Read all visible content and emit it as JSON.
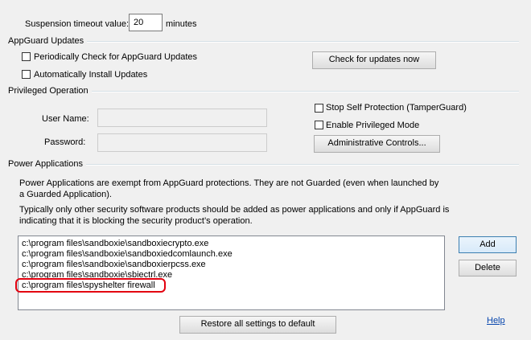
{
  "suspension": {
    "label": "Suspension timeout value:",
    "value": "20",
    "unit": "minutes"
  },
  "updates": {
    "group_title": "AppGuard Updates",
    "periodic_check_label": "Periodically Check for AppGuard Updates",
    "periodic_check_checked": false,
    "auto_install_label": "Automatically Install Updates",
    "auto_install_checked": false,
    "check_now_button": "Check for updates now"
  },
  "privileged": {
    "group_title": "Privileged Operation",
    "username_label": "User Name:",
    "username_value": "",
    "password_label": "Password:",
    "password_value": "",
    "stop_self_protection_label": "Stop Self Protection (TamperGuard)",
    "stop_self_protection_checked": false,
    "enable_privileged_label": "Enable Privileged Mode",
    "enable_privileged_checked": false,
    "admin_controls_button": "Administrative Controls..."
  },
  "power_apps": {
    "group_title": "Power Applications",
    "description_1_line_1": "Power Applications are exempt from AppGuard protections.  They are not Guarded (even when launched by",
    "description_1_line_2": "a Guarded Application).",
    "description_2_line_1": "Typically only other security software products should be added as power applications and only if AppGuard is",
    "description_2_line_2": "indicating that it is blocking the security product’s operation.",
    "items": [
      "c:\\program files\\sandboxie\\sandboxiecrypto.exe",
      "c:\\program files\\sandboxie\\sandboxiedcomlaunch.exe",
      "c:\\program files\\sandboxie\\sandboxierpcss.exe",
      "c:\\program files\\sandboxie\\sbiectrl.exe",
      "c:\\program files\\spyshelter firewall"
    ],
    "add_button": "Add",
    "delete_button": "Delete"
  },
  "footer": {
    "restore_button": "Restore all settings to default",
    "help_link": "Help"
  },
  "colors": {
    "highlight": "#e3000f",
    "link": "#0645ad",
    "focus_border": "#3c7fb1"
  }
}
